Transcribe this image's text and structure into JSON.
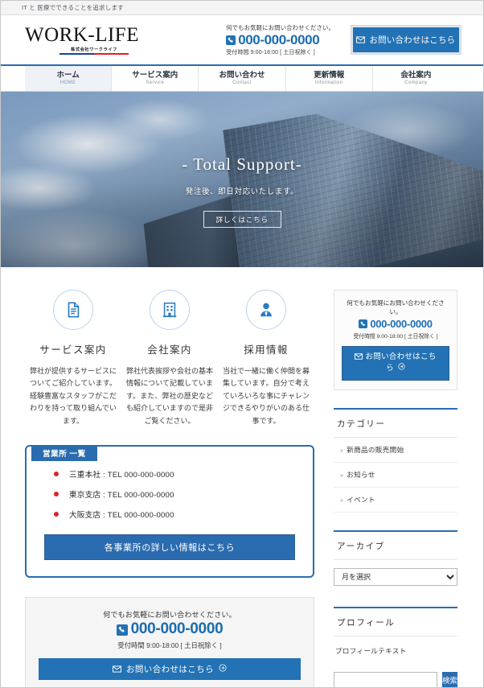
{
  "topbar": {
    "tagline": "IT と 医療でできることを追求します"
  },
  "header": {
    "logo_main": "WORK-LIFE",
    "logo_sub": "株式会社ワークライフ",
    "contact_lead": "何でもお気軽にお問い合わせください。",
    "tel": "000-000-0000",
    "hours": "受付時間 9:00-18:00 [ 土日祝除く ]",
    "cta_label": "お問い合わせはこちら"
  },
  "nav": {
    "items": [
      {
        "ja": "ホーム",
        "en": "HOME",
        "active": true
      },
      {
        "ja": "サービス案内",
        "en": "Service",
        "active": false
      },
      {
        "ja": "お問い合わせ",
        "en": "Contact",
        "active": false
      },
      {
        "ja": "更新情報",
        "en": "Information",
        "active": false
      },
      {
        "ja": "会社案内",
        "en": "Company",
        "active": false
      }
    ]
  },
  "hero": {
    "title": "- Total Support-",
    "subtitle": "発注後、即日対応いたします。",
    "button_label": "詳しくはこちら"
  },
  "features": [
    {
      "icon": "document-icon",
      "title": "サービス案内",
      "text": "弊社が提供するサービスについてご紹介しています。経験豊富なスタッフがこだわりを持って取り組んでいます。"
    },
    {
      "icon": "building-icon",
      "title": "会社案内",
      "text": "弊社代表挨拶や会社の基本情報について記載しています。また、弊社の歴史なども紹介していますので是非ご覧ください。"
    },
    {
      "icon": "person-icon",
      "title": "採用情報",
      "text": "当社で一緒に働く仲間を募集しています。自分で考えていろいろな事にチャレンジできるやりがいのある仕事です。"
    }
  ],
  "offices": {
    "tab_label": "営業所 一覧",
    "items": [
      "三重本社 : TEL 000-000-0000",
      "東京支店 : TEL 000-000-0000",
      "大阪支店 : TEL 000-000-0000"
    ],
    "button_label": "各事業所の詳しい情報はこちら"
  },
  "contact_box": {
    "lead": "何でもお気軽にお問い合わせください。",
    "tel": "000-000-0000",
    "hours": "受付時間 9:00-18:00 [ 土日祝除く ]",
    "button_label": "お問い合わせはこちら",
    "button_arrow": "➔"
  },
  "sidebar": {
    "contact": {
      "lead": "何でもお気軽にお問い合わせください。",
      "tel": "000-000-0000",
      "hours": "受付時間 9:00-18:00 [ 土日祝除く ]",
      "button_label": "お問い合わせはこち",
      "button_label2": "ら",
      "button_arrow": "➔"
    },
    "category": {
      "title": "カテゴリー",
      "items": [
        "新商品の販売開始",
        "お知らせ",
        "イベント"
      ]
    },
    "archive": {
      "title": "アーカイブ",
      "selected": "月を選択",
      "options": [
        "月を選択"
      ]
    },
    "profile": {
      "title": "プロフィール",
      "text": "プロフィールテキスト"
    },
    "search": {
      "value": "",
      "placeholder": "",
      "button_label": "検索"
    }
  },
  "colors": {
    "primary": "#2b6cb0",
    "tel_blue": "#1c6cb1",
    "accent_red": "#d8232a",
    "logo_blue": "#17439b"
  }
}
